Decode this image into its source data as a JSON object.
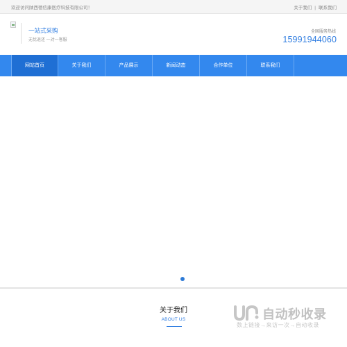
{
  "topbar": {
    "welcome": "欢迎访问陕西德信康医疗科技有限公司！",
    "links": [
      "关于我们",
      "联系我们"
    ],
    "separator": "|"
  },
  "header": {
    "slogan_title": "一站式采购",
    "slogan_sub": "无忧退还 一对一客服",
    "hotline_label": "全国服务热线",
    "hotline_number": "15991944060"
  },
  "nav": {
    "items": [
      "网站首页",
      "关于我们",
      "产品展示",
      "新闻动态",
      "合作单位",
      "联系我们"
    ],
    "active_index": 0
  },
  "banner": {
    "slide_count": 1,
    "active_slide": 1
  },
  "about": {
    "title": "关于我们",
    "subtitle": "ABOUT US"
  },
  "watermark": {
    "name": "自动秒收录",
    "slogan": "数上链接→来访一次→自动收录"
  },
  "colors": {
    "accent": "#2f7de1",
    "nav_bg": "#3388ee",
    "nav_active": "#1f6fd4",
    "topbar_bg": "#f5f5f5"
  }
}
